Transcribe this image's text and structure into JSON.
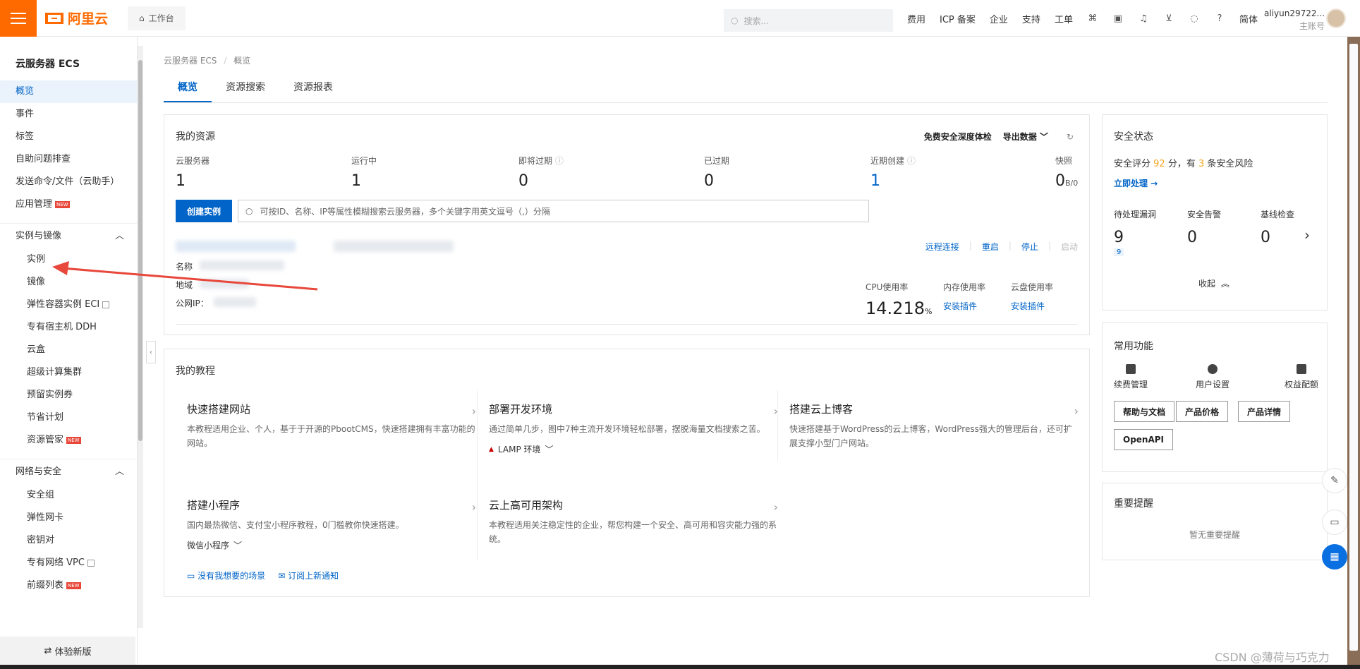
{
  "topbar": {
    "logo_text": "阿里云",
    "workbench": "工作台",
    "search_placeholder": "搜索...",
    "nav": [
      "费用",
      "ICP 备案",
      "企业",
      "支持",
      "工单"
    ],
    "lang": "简体",
    "username": "aliyun29722...",
    "account_type": "主账号"
  },
  "sidebar": {
    "title": "云服务器 ECS",
    "top_items": [
      {
        "label": "概览"
      },
      {
        "label": "事件"
      },
      {
        "label": "标签"
      },
      {
        "label": "自助问题排查"
      },
      {
        "label": "发送命令/文件（云助手）"
      },
      {
        "label": "应用管理",
        "badge": "NEW"
      }
    ],
    "group1": {
      "label": "实例与镜像",
      "items": [
        {
          "label": "实例"
        },
        {
          "label": "镜像"
        },
        {
          "label": "弹性容器实例 ECI"
        },
        {
          "label": "专有宿主机 DDH"
        },
        {
          "label": "云盒"
        },
        {
          "label": "超级计算集群"
        },
        {
          "label": "预留实例券"
        },
        {
          "label": "节省计划"
        },
        {
          "label": "资源管家",
          "badge": "NEW"
        }
      ]
    },
    "group2": {
      "label": "网络与安全",
      "items": [
        {
          "label": "安全组"
        },
        {
          "label": "弹性网卡"
        },
        {
          "label": "密钥对"
        },
        {
          "label": "专有网络 VPC"
        },
        {
          "label": "前缀列表",
          "badge": "NEW"
        }
      ]
    },
    "try_new": "体验新版"
  },
  "breadcrumb": {
    "root": "云服务器 ECS",
    "sep": "/",
    "current": "概览"
  },
  "tabs": [
    "概览",
    "资源搜索",
    "资源报表"
  ],
  "resources": {
    "title": "我的资源",
    "action_security": "免费安全深度体检",
    "action_export": "导出数据",
    "stats": [
      {
        "label": "云服务器",
        "value": "1"
      },
      {
        "label": "运行中",
        "value": "1"
      },
      {
        "label": "即将过期",
        "value": "0"
      },
      {
        "label": "已过期",
        "value": "0"
      },
      {
        "label": "近期创建",
        "value": "1"
      },
      {
        "label": "快照",
        "value": "0",
        "unit": "B/0"
      }
    ],
    "create_btn": "创建实例",
    "search_placeholder": "可按ID、名称、IP等属性模糊搜索云服务器，多个关键字用英文逗号（,）分隔",
    "instance_actions": [
      "远程连接",
      "重启",
      "停止",
      "启动"
    ],
    "labels": {
      "name": "名称",
      "region": "地域",
      "public_ip": "公网IP："
    },
    "cpu_label": "CPU使用率",
    "cpu_value": "14.218",
    "cpu_unit": "%",
    "mem_label": "内存使用率",
    "disk_label": "云盘使用率",
    "install_plugin": "安装插件"
  },
  "tutorials": {
    "title": "我的教程",
    "items": [
      {
        "title": "快速搭建网站",
        "desc": "本教程适用企业、个人，基于于开源的PbootCMS，快速搭建拥有丰富功能的网站。"
      },
      {
        "title": "部署开发环境",
        "desc": "通过简单几步，图中7种主流开发环境轻松部署，摆脱海量文档搜索之苦。",
        "extra": "LAMP 环境"
      },
      {
        "title": "搭建云上博客",
        "desc": "快速搭建基于WordPress的云上博客，WordPress强大的管理后台，还可扩展支撑小型门户网站。"
      },
      {
        "title": "搭建小程序",
        "desc": "国内最热微信、支付宝小程序教程，0门槛教你快速搭建。",
        "extra": "微信小程序"
      },
      {
        "title": "云上高可用架构",
        "desc": "本教程适用关注稳定性的企业，帮您构建一个安全、高可用和容灾能力强的系统。"
      }
    ],
    "link_scene": "没有我想要的场景",
    "link_subscribe": "订阅上新通知"
  },
  "security": {
    "title": "安全状态",
    "score_prefix": "安全评分",
    "score": "92",
    "score_mid": "分，有",
    "risk_count": "3",
    "score_suffix": "条安全风险",
    "handle_link": "立即处理 →",
    "stats": [
      {
        "label": "待处理漏洞",
        "value": "9",
        "tag": "9"
      },
      {
        "label": "安全告警",
        "value": "0"
      },
      {
        "label": "基线检查",
        "value": "0"
      }
    ],
    "fold": "收起"
  },
  "functions": {
    "title": "常用功能",
    "icons": [
      "续费管理",
      "用户设置",
      "权益配额"
    ],
    "buttons": [
      "帮助与文档",
      "产品价格",
      "产品详情",
      "OpenAPI"
    ]
  },
  "notice": {
    "title": "重要提醒",
    "empty": "暂无重要提醒"
  },
  "watermark": "CSDN @薄荷与巧克力",
  "colors": {
    "brand": "#ff6a00",
    "primary": "#0064c8",
    "warning": "#f5a623",
    "annotation_arrow": "#e8473b"
  }
}
